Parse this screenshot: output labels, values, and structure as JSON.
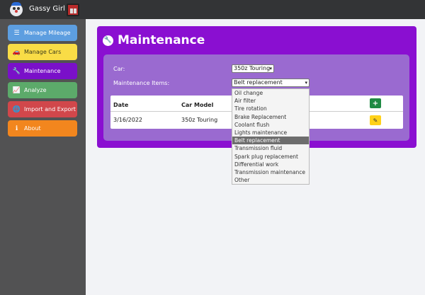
{
  "app": {
    "title": "Gassy Girl"
  },
  "sidebar": {
    "items": [
      {
        "label": "Manage Mileage",
        "icon": "list-icon"
      },
      {
        "label": "Manage Cars",
        "icon": "car-icon"
      },
      {
        "label": "Maintenance",
        "icon": "wrench-icon"
      },
      {
        "label": "Analyze",
        "icon": "chart-icon"
      },
      {
        "label": "Import and Export",
        "icon": "globe-icon"
      },
      {
        "label": "About",
        "icon": "info-icon"
      }
    ]
  },
  "page": {
    "title": "Maintenance"
  },
  "form": {
    "car_label": "Car:",
    "car_value": "350z Touring",
    "items_label": "Maintenance Items:",
    "items_value": "Belt replacement"
  },
  "dropdown": {
    "options": [
      "Oil change",
      "Air filter",
      "Tire rotation",
      "Brake Replacement",
      "Coolant flush",
      "Lights maintenance",
      "Belt replacement",
      "Transmission fluid",
      "Spark plug replacement",
      "Differential work",
      "Transmission maintenance",
      "Other"
    ],
    "selected_index": 6
  },
  "table": {
    "headers": [
      "Date",
      "Car Model"
    ],
    "rows": [
      {
        "date": "3/16/2022",
        "car_model": "350z Touring"
      }
    ]
  },
  "colors": {
    "accent": "#8a0fd1",
    "panel": "#9a6ad0",
    "add_button": "#1f8a43",
    "edit_button": "#ffd11a"
  }
}
